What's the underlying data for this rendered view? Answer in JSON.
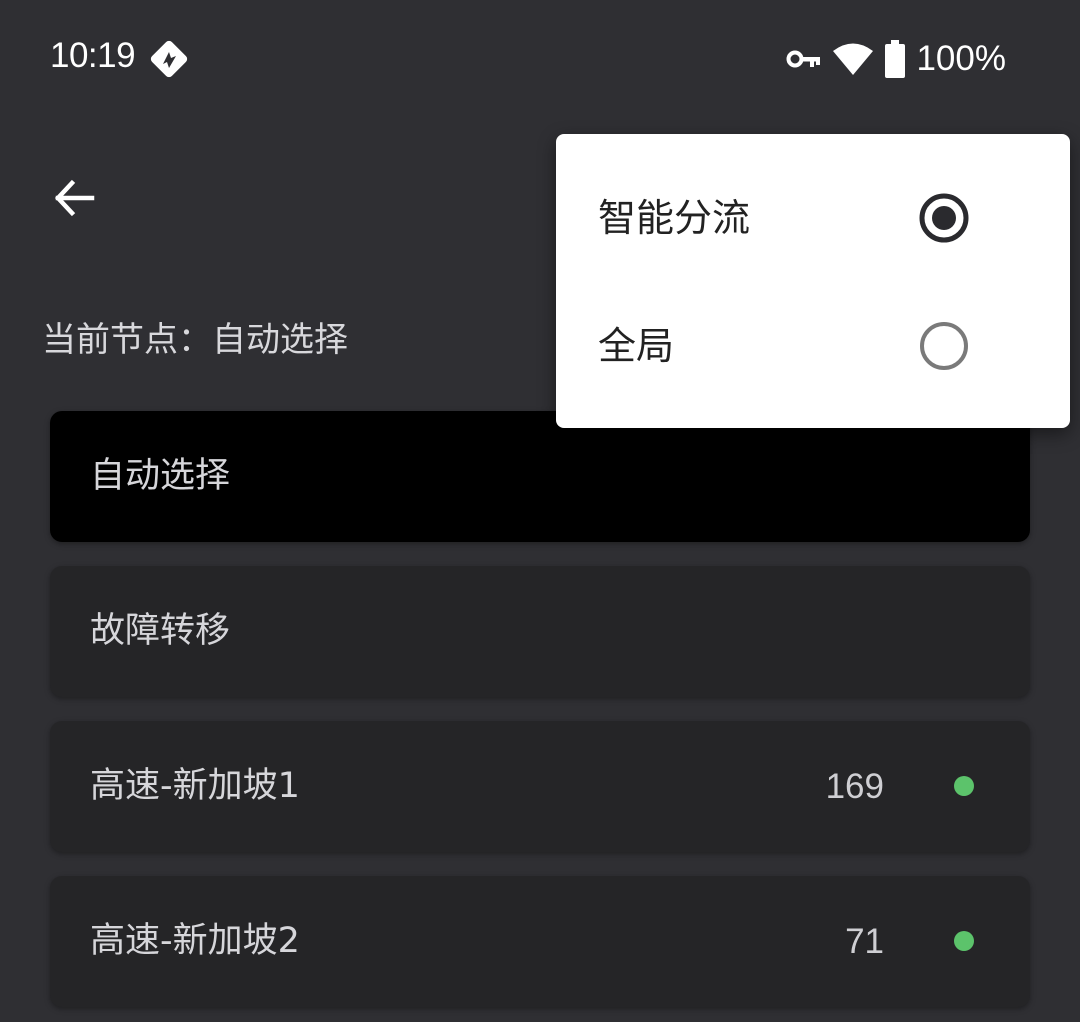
{
  "status_bar": {
    "time": "10:19",
    "battery": "100%",
    "icons": [
      "app-notification-icon",
      "vpn-key-icon",
      "wifi-icon",
      "battery-icon"
    ]
  },
  "toolbar": {
    "back_icon": "arrow-left-icon"
  },
  "current_node": {
    "label": "当前节点：自动选择"
  },
  "proxies": [
    {
      "name": "自动选择",
      "latency": "",
      "selected": true
    },
    {
      "name": "故障转移",
      "latency": "",
      "selected": false
    },
    {
      "name": "高速-新加坡1",
      "latency": "169",
      "selected": false,
      "status": "online"
    },
    {
      "name": "高速-新加坡2",
      "latency": "71",
      "selected": false,
      "status": "online"
    }
  ],
  "mode_menu": {
    "options": [
      {
        "label": "智能分流",
        "checked": true
      },
      {
        "label": "全局",
        "checked": false
      }
    ]
  },
  "colors": {
    "background": "#2f2f33",
    "card": "#252527",
    "selected_card": "#000000",
    "online_dot": "#5cc36b",
    "radio_checked": "#2a2a2e",
    "radio_unchecked": "#7a7a7a"
  }
}
